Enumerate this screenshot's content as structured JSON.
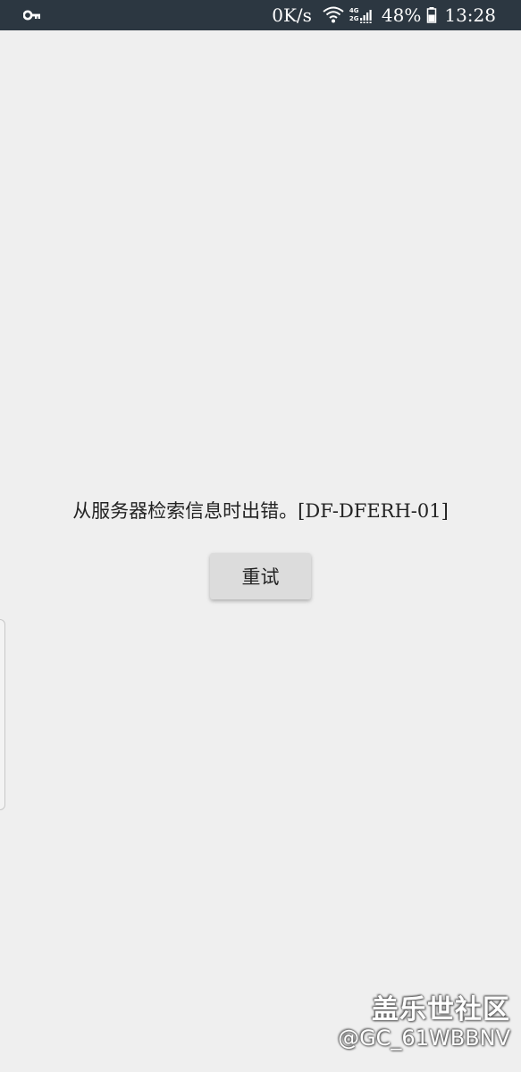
{
  "status_bar": {
    "left_icon": "key-icon",
    "network_speed": "0K/s",
    "wifi_icon": "wifi-icon",
    "network_top": "4G",
    "network_bottom": "2G",
    "battery_percent": "48%",
    "battery_icon": "battery-icon",
    "time": "13:28",
    "background": "#2c3741"
  },
  "content": {
    "error_message": "从服务器检索信息时出错。[DF-DFERH-01]",
    "retry_label": "重试"
  },
  "watermark": {
    "brand": "盖乐世社区",
    "user": "@GC_61WBBNV"
  },
  "colors": {
    "page_background": "#efefef",
    "button_background": "#dcdcdc"
  }
}
